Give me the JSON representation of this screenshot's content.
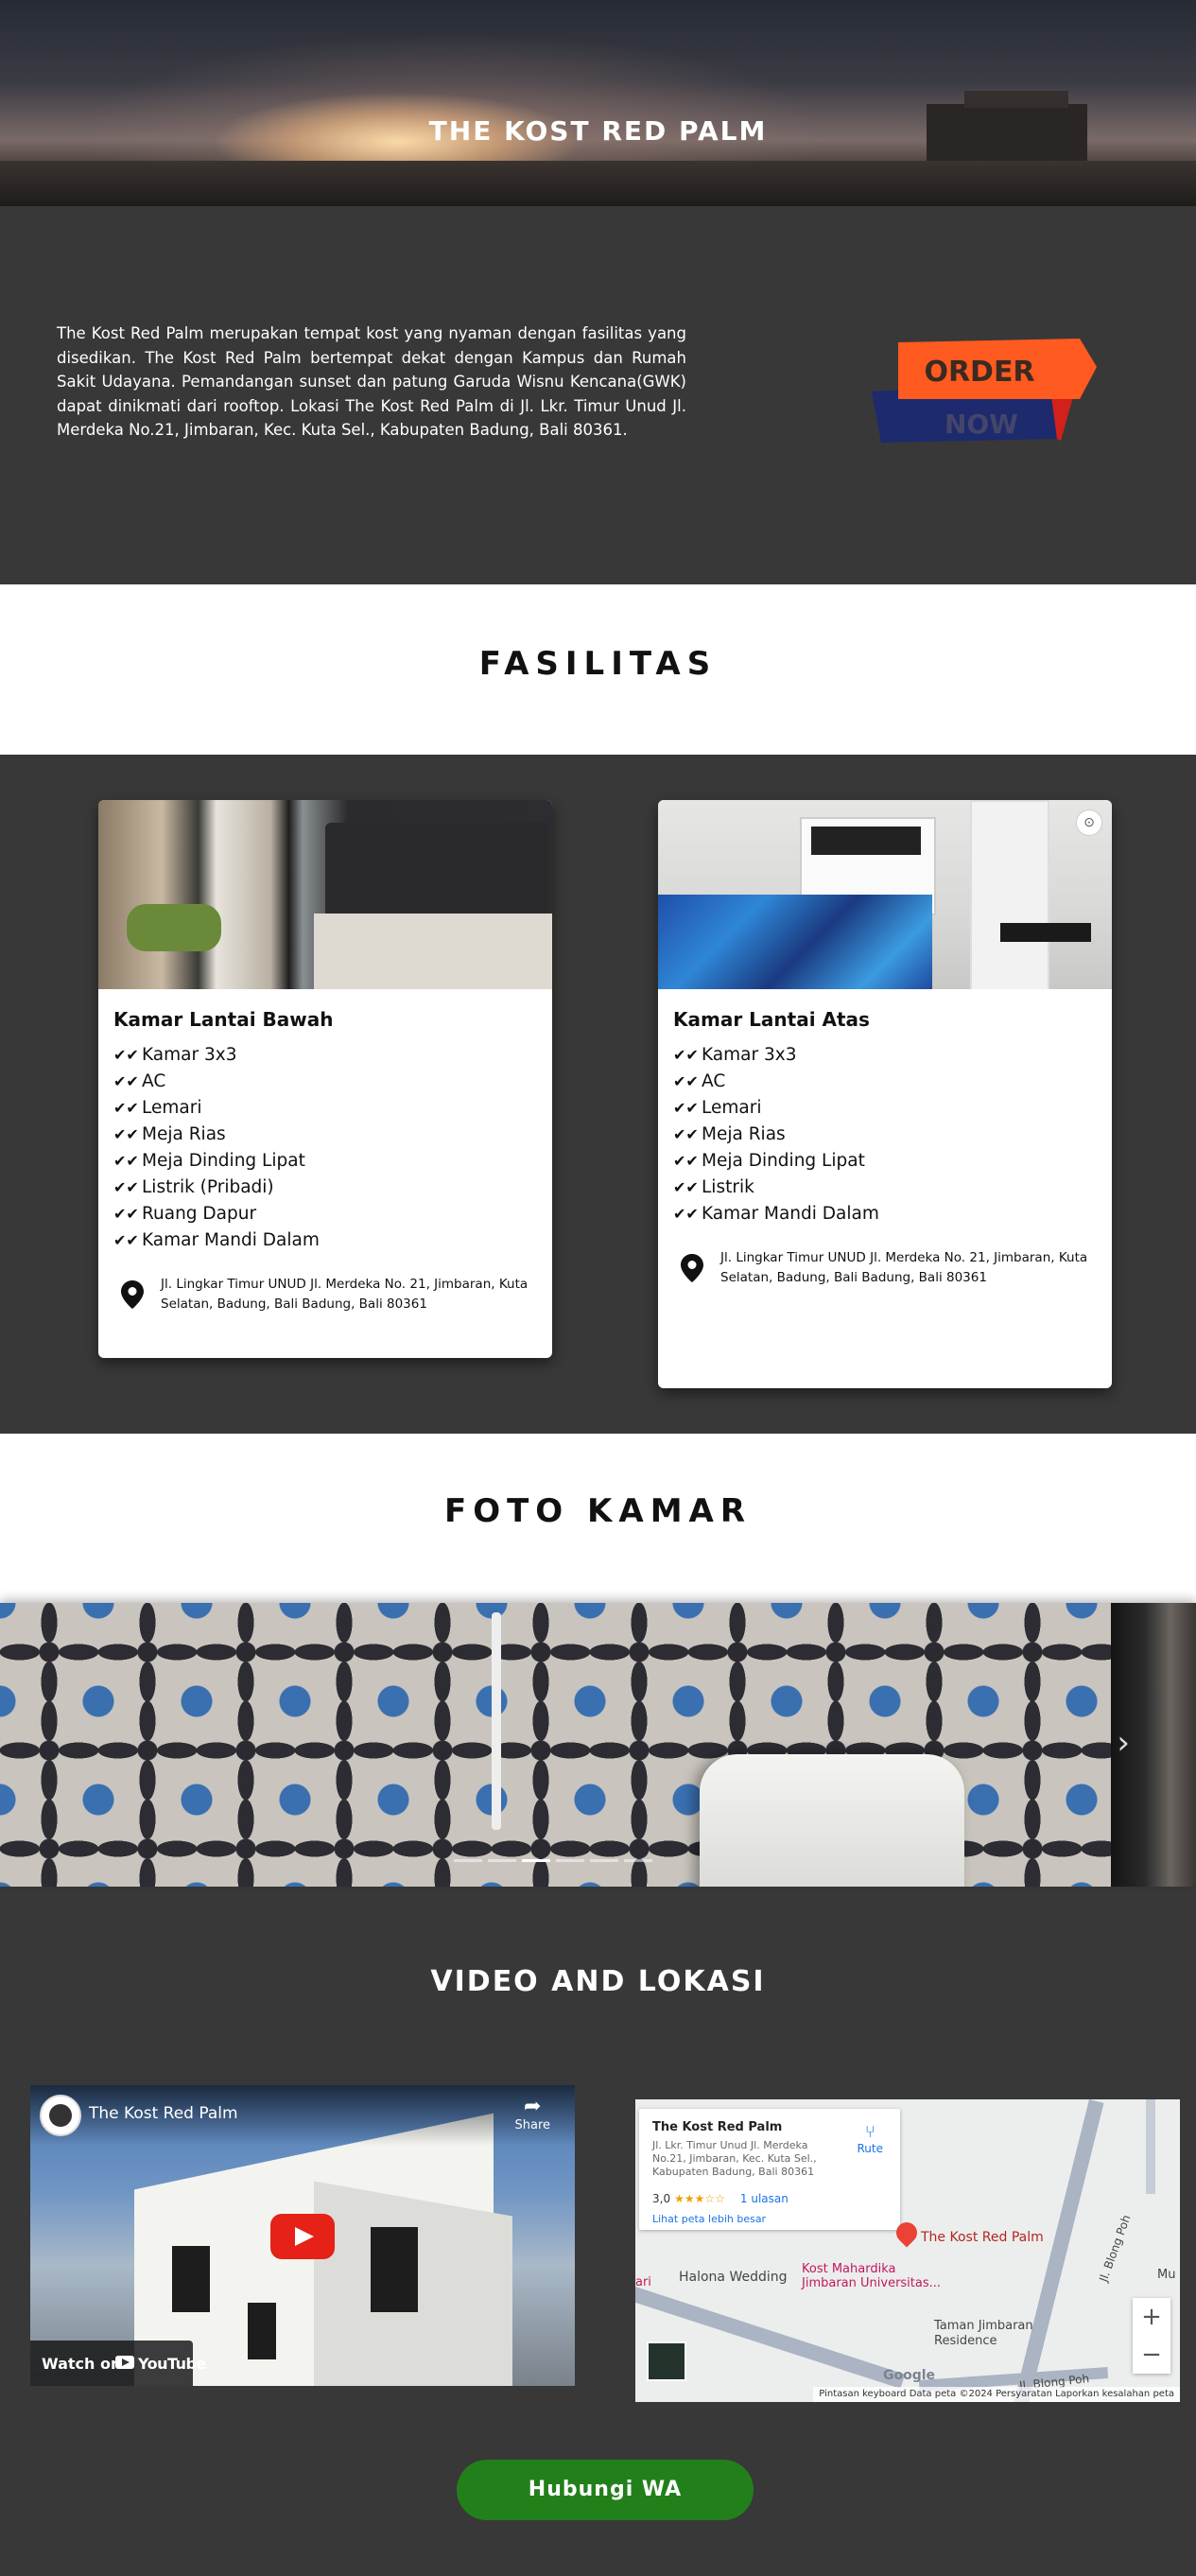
{
  "hero": {
    "title": "THE KOST RED PALM"
  },
  "intro": {
    "description": "The Kost Red Palm merupakan tempat kost yang nyaman dengan fasilitas yang disedikan. The Kost Red Palm bertempat dekat dengan Kampus dan Rumah Sakit Udayana. Pemandangan sunset dan patung Garuda Wisnu Kencana(GWK) dapat dinikmati dari rooftop. Lokasi The Kost Red Palm di Jl. Lkr. Timur Unud Jl. Merdeka No.21, Jimbaran, Kec. Kuta Sel., Kabupaten Badung, Bali 80361.",
    "order_top": "ORDER",
    "order_bottom": "NOW",
    "colors": {
      "order_orange": "#ff5a1f",
      "order_navy": "#1d2a6e"
    }
  },
  "facilities": {
    "heading": "FASILITAS",
    "cards": [
      {
        "title": "Kamar Lantai Bawah",
        "items": [
          "Kamar 3x3",
          "AC",
          "Lemari",
          "Meja Rias",
          "Meja Dinding Lipat",
          "Listrik (Pribadi)",
          "Ruang Dapur",
          "Kamar Mandi Dalam"
        ],
        "address": "Jl. Lingkar Timur UNUD Jl. Merdeka No. 21, Jimbaran, Kuta Selatan, Badung, Bali Badung, Bali 80361"
      },
      {
        "title": "Kamar Lantai Atas",
        "items": [
          "Kamar 3x3",
          "AC",
          "Lemari",
          "Meja Rias",
          "Meja Dinding Lipat",
          "Listrik",
          "Kamar Mandi Dalam"
        ],
        "address": "Jl. Lingkar Timur UNUD Jl. Merdeka No. 21, Jimbaran, Kuta Selatan, Badung, Bali Badung, Bali 80361"
      }
    ]
  },
  "gallery": {
    "heading": "FOTO KAMAR",
    "next_icon": "chevron-right-icon"
  },
  "video_location": {
    "heading": "VIDEO AND LOKASI",
    "video": {
      "title": "The Kost Red Palm",
      "share": "Share",
      "watch_on": "Watch on",
      "youtube": "YouTube"
    },
    "map": {
      "place_name": "The Kost Red Palm",
      "place_address": "Jl. Lkr. Timur Unud Jl. Merdeka No.21, Jimbaran, Kec. Kuta Sel., Kabupaten Badung, Bali 80361",
      "rating": "3,0",
      "reviews": "1 ulasan",
      "route": "Rute",
      "view_larger": "Lihat peta lebih besar",
      "pin_label": "The Kost Red Palm",
      "poi_1": "Halona Wedding",
      "poi_2": "Kost Mahardika Jimbaran Universitas...",
      "poi_3": "Taman Jimbaran Residence",
      "road_1": "Jl. Blong Poh",
      "road_2": "Jl. Blong Poh",
      "edge_1": "Mu",
      "edge_2": "ari",
      "logo": "Google",
      "footer": "Pintasan keyboard   Data peta ©2024   Persyaratan   Laporkan kesalahan peta",
      "zoom_in": "+",
      "zoom_out": "−"
    }
  },
  "contact": {
    "wa_button": "Hubungi WA",
    "color": "#22801a"
  }
}
